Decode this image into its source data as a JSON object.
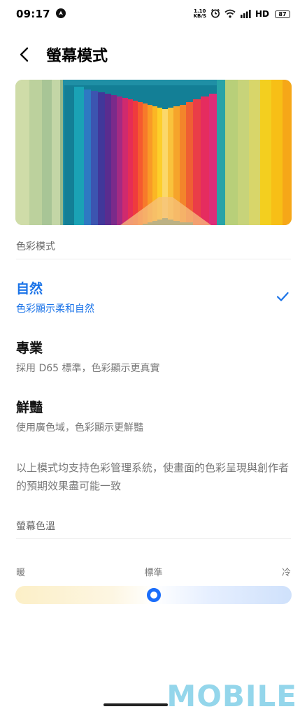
{
  "status_bar": {
    "time": "09:17",
    "net_speed_value": "1.10",
    "net_speed_unit": "KB/S",
    "network_type": "HD",
    "battery": "87"
  },
  "header": {
    "title": "螢幕模式"
  },
  "color_mode": {
    "section_label": "色彩模式",
    "options": [
      {
        "title": "自然",
        "desc": "色彩顯示柔和自然",
        "selected": true
      },
      {
        "title": "專業",
        "desc": "採用 D65 標準，色彩顯示更真實",
        "selected": false
      },
      {
        "title": "鮮豔",
        "desc": "使用廣色域，色彩顯示更鮮豔",
        "selected": false
      }
    ],
    "info": "以上模式均支持色彩管理系統，使畫面的色彩呈現與創作者的預期效果盡可能一致"
  },
  "color_temp": {
    "section_label": "螢幕色溫",
    "warm_label": "暖",
    "standard_label": "標準",
    "cold_label": "冷",
    "value_fraction": 0.5
  },
  "watermark": "MOBILE",
  "colors": {
    "accent": "#1a73e8",
    "slider_thumb": "#1a6dfa"
  }
}
